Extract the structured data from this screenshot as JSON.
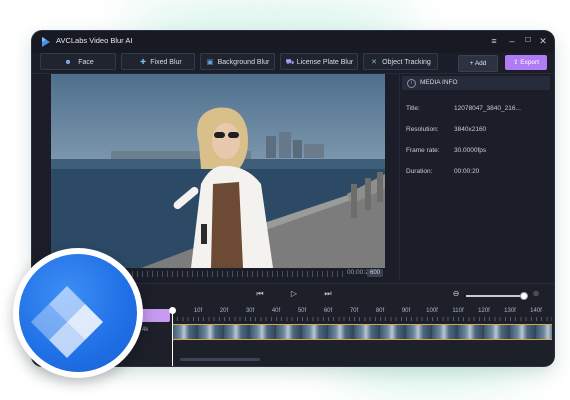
{
  "app": {
    "title": "AVCLabs Video Blur AI"
  },
  "window_controls": {
    "menu": "≡",
    "minimize": "–",
    "maximize": "☐",
    "close": "✕"
  },
  "toolbar": {
    "tools": [
      {
        "label": "Face",
        "icon": "face-icon"
      },
      {
        "label": "Fixed Blur",
        "icon": "crosshair-icon"
      },
      {
        "label": "Background Blur",
        "icon": "background-icon"
      },
      {
        "label": "License Plate Blur",
        "icon": "car-icon"
      },
      {
        "label": "Object Tracking",
        "icon": "cross-icon"
      }
    ],
    "add_label": "+ Add",
    "export_label": "Export",
    "accent": "#b07cf5"
  },
  "preview": {
    "current_time": "00:00:20",
    "duration_badge": "600"
  },
  "media_info": {
    "title": "MEDIA INFO",
    "rows": [
      {
        "key": "Title:",
        "value": "12078047_3840_216..."
      },
      {
        "key": "Resolution:",
        "value": "3840x2160"
      },
      {
        "key": "Frame rate:",
        "value": "30.0000fps"
      },
      {
        "key": "Duration:",
        "value": "00:00:20"
      }
    ]
  },
  "timeline": {
    "ruler": [
      "10f",
      "20f",
      "30f",
      "40f",
      "50f",
      "60f",
      "70f",
      "80f",
      "90f",
      "100f",
      "110f",
      "120f",
      "130f",
      "140f"
    ],
    "track_label": "4k",
    "zoom_out": "⊖",
    "zoom_in": "⊕",
    "prev": "⏮",
    "play": "▷",
    "next": "⏭"
  },
  "colors": {
    "background": "#1b1e28",
    "accent": "#b07cf5",
    "logo_blue": "#1f6fe6"
  }
}
